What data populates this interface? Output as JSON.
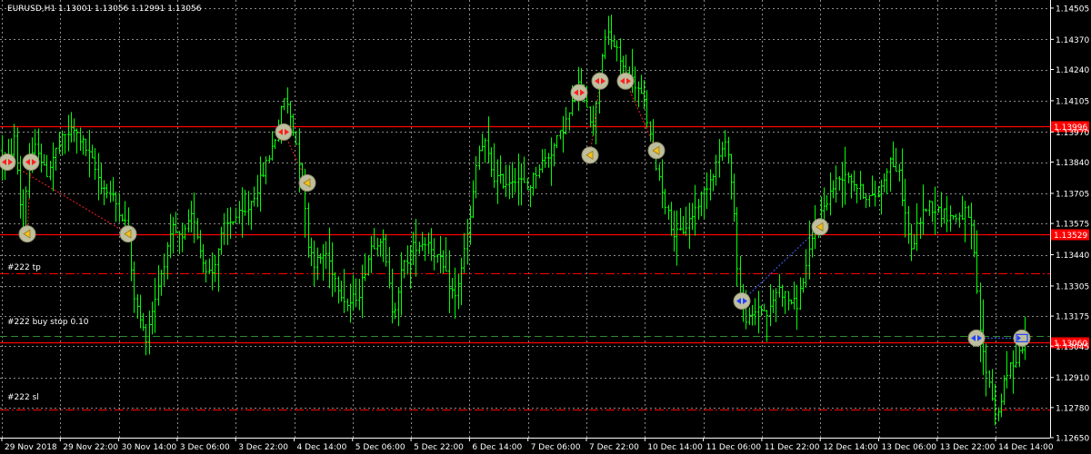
{
  "symbol_header": "EURUSD,H1  1.13001 1.13056 1.12991 1.13056",
  "colors": {
    "background": "#000000",
    "grid": "#8a8a8a",
    "bull": "#00ff00",
    "bear": "#00ff00",
    "level_line": "#ff0000",
    "tp_line": "#ff0000",
    "sl_line": "#ff0000",
    "order_line": "#2e8b2e",
    "axis_text": "#ffffff"
  },
  "order_labels": {
    "tp": "#222 tp",
    "buy_stop": "#222 buy stop 0.10",
    "sl": "#222 sl"
  },
  "chart_data": {
    "type": "ohlc",
    "symbol": "EURUSD",
    "timeframe": "H1",
    "ylim": [
      1.1265,
      1.1454
    ],
    "y_ticks": [
      "1.14505",
      "1.14370",
      "1.14240",
      "1.14105",
      "1.13970",
      "1.13840",
      "1.13705",
      "1.13575",
      "1.13440",
      "1.13305",
      "1.13175",
      "1.13045",
      "1.12910",
      "1.12780",
      "1.12650"
    ],
    "x_ticks": [
      "29 Nov 2018",
      "29 Nov 22:00",
      "30 Nov 14:00",
      "3 Dec 06:00",
      "3 Dec 22:00",
      "4 Dec 14:00",
      "5 Dec 06:00",
      "5 Dec 22:00",
      "6 Dec 14:00",
      "7 Dec 06:00",
      "7 Dec 22:00",
      "10 Dec 14:00",
      "11 Dec 06:00",
      "11 Dec 22:00",
      "12 Dec 14:00",
      "13 Dec 06:00",
      "13 Dec 22:00",
      "14 Dec 14:00"
    ],
    "horizontal_levels": [
      {
        "price": 1.13996,
        "label": "1.13996",
        "style": "solid"
      },
      {
        "price": 1.13529,
        "label": "1.13529",
        "style": "solid"
      },
      {
        "price": 1.1306,
        "label": "1.13060",
        "style": "solid"
      }
    ],
    "order_lines": [
      {
        "kind": "tp",
        "price": 1.1336,
        "style": "dashed"
      },
      {
        "kind": "buy_stop",
        "price": 1.1309,
        "style": "dashed"
      },
      {
        "kind": "sl",
        "price": 1.1277,
        "style": "dashed"
      }
    ],
    "waypoints": [
      [
        0,
        1.1389
      ],
      [
        8,
        1.1383
      ],
      [
        16,
        1.1395
      ],
      [
        20,
        1.1372
      ],
      [
        25,
        1.1356
      ],
      [
        30,
        1.138
      ],
      [
        40,
        1.1392
      ],
      [
        50,
        1.1378
      ],
      [
        60,
        1.1388
      ],
      [
        70,
        1.1395
      ],
      [
        80,
        1.1398
      ],
      [
        90,
        1.1393
      ],
      [
        100,
        1.1385
      ],
      [
        110,
        1.1375
      ],
      [
        125,
        1.1368
      ],
      [
        135,
        1.136
      ],
      [
        140,
        1.1355
      ],
      [
        145,
        1.133
      ],
      [
        152,
        1.1318
      ],
      [
        160,
        1.1308
      ],
      [
        168,
        1.1322
      ],
      [
        178,
        1.1338
      ],
      [
        190,
        1.1355
      ],
      [
        200,
        1.135
      ],
      [
        212,
        1.1362
      ],
      [
        222,
        1.1342
      ],
      [
        232,
        1.1335
      ],
      [
        245,
        1.1355
      ],
      [
        258,
        1.136
      ],
      [
        270,
        1.1362
      ],
      [
        285,
        1.1375
      ],
      [
        297,
        1.1388
      ],
      [
        305,
        1.1398
      ],
      [
        312,
        1.1412
      ],
      [
        318,
        1.1405
      ],
      [
        325,
        1.1393
      ],
      [
        332,
        1.1378
      ],
      [
        338,
        1.135
      ],
      [
        346,
        1.134
      ],
      [
        358,
        1.1345
      ],
      [
        370,
        1.1332
      ],
      [
        382,
        1.1322
      ],
      [
        395,
        1.1328
      ],
      [
        408,
        1.1348
      ],
      [
        420,
        1.1352
      ],
      [
        432,
        1.1318
      ],
      [
        442,
        1.1338
      ],
      [
        455,
        1.1348
      ],
      [
        470,
        1.135
      ],
      [
        485,
        1.134
      ],
      [
        500,
        1.1325
      ],
      [
        510,
        1.1345
      ],
      [
        518,
        1.1362
      ],
      [
        525,
        1.1388
      ],
      [
        533,
        1.1392
      ],
      [
        542,
        1.1378
      ],
      [
        555,
        1.1375
      ],
      [
        568,
        1.1378
      ],
      [
        580,
        1.1372
      ],
      [
        592,
        1.1382
      ],
      [
        605,
        1.1388
      ],
      [
        615,
        1.1395
      ],
      [
        626,
        1.1405
      ],
      [
        636,
        1.1418
      ],
      [
        645,
        1.141
      ],
      [
        652,
        1.1398
      ],
      [
        660,
        1.1428
      ],
      [
        668,
        1.144
      ],
      [
        678,
        1.1432
      ],
      [
        688,
        1.1422
      ],
      [
        698,
        1.1418
      ],
      [
        708,
        1.141
      ],
      [
        716,
        1.1392
      ],
      [
        722,
        1.1382
      ],
      [
        728,
        1.1372
      ],
      [
        734,
        1.1362
      ],
      [
        742,
        1.1352
      ],
      [
        752,
        1.1355
      ],
      [
        762,
        1.1362
      ],
      [
        772,
        1.137
      ],
      [
        782,
        1.1378
      ],
      [
        792,
        1.1388
      ],
      [
        800,
        1.1392
      ],
      [
        808,
        1.1358
      ],
      [
        812,
        1.1328
      ],
      [
        818,
        1.1318
      ],
      [
        825,
        1.1315
      ],
      [
        834,
        1.1322
      ],
      [
        845,
        1.1318
      ],
      [
        855,
        1.133
      ],
      [
        866,
        1.1325
      ],
      [
        876,
        1.1322
      ],
      [
        886,
        1.1338
      ],
      [
        896,
        1.1355
      ],
      [
        906,
        1.1365
      ],
      [
        918,
        1.1375
      ],
      [
        930,
        1.138
      ],
      [
        945,
        1.1372
      ],
      [
        958,
        1.1368
      ],
      [
        968,
        1.1372
      ],
      [
        978,
        1.1385
      ],
      [
        988,
        1.138
      ],
      [
        995,
        1.1362
      ],
      [
        1002,
        1.1345
      ],
      [
        1010,
        1.1358
      ],
      [
        1020,
        1.1366
      ],
      [
        1035,
        1.1362
      ],
      [
        1050,
        1.136
      ],
      [
        1062,
        1.1362
      ],
      [
        1070,
        1.1352
      ],
      [
        1076,
        1.1318
      ],
      [
        1082,
        1.1298
      ],
      [
        1090,
        1.1285
      ],
      [
        1096,
        1.1272
      ],
      [
        1102,
        1.1285
      ],
      [
        1110,
        1.1295
      ],
      [
        1118,
        1.13
      ],
      [
        1126,
        1.1306
      ]
    ],
    "trade_markers": [
      {
        "x": 8,
        "price": 1.1384,
        "kind": "sell"
      },
      {
        "x": 34,
        "price": 1.1384,
        "kind": "sell"
      },
      {
        "x": 30,
        "price": 1.1353,
        "kind": "close"
      },
      {
        "x": 141,
        "price": 1.1353,
        "kind": "close"
      },
      {
        "x": 312,
        "price": 1.1397,
        "kind": "sell"
      },
      {
        "x": 338,
        "price": 1.1375,
        "kind": "close"
      },
      {
        "x": 637,
        "price": 1.1414,
        "kind": "sell"
      },
      {
        "x": 660,
        "price": 1.1419,
        "kind": "sell"
      },
      {
        "x": 688,
        "price": 1.1419,
        "kind": "sell"
      },
      {
        "x": 649,
        "price": 1.1387,
        "kind": "close"
      },
      {
        "x": 722,
        "price": 1.1389,
        "kind": "close"
      },
      {
        "x": 816,
        "price": 1.1324,
        "kind": "buy"
      },
      {
        "x": 902,
        "price": 1.1356,
        "kind": "close"
      },
      {
        "x": 1074,
        "price": 1.1308,
        "kind": "buy"
      },
      {
        "x": 1124,
        "price": 1.1308,
        "kind": "buybox"
      }
    ]
  }
}
